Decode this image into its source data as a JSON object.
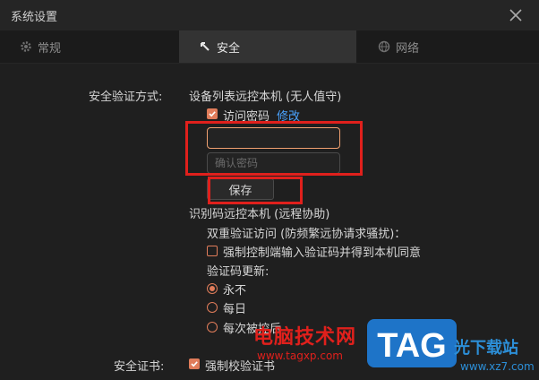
{
  "window": {
    "title": "系统设置"
  },
  "tabs": [
    {
      "label": "常规",
      "icon": "gear-icon"
    },
    {
      "label": "安全",
      "icon": "plug-icon"
    },
    {
      "label": "网络",
      "icon": "globe-icon"
    }
  ],
  "security": {
    "verification_label": "安全验证方式:",
    "device_list_heading": "设备列表远控本机 (无人值守)",
    "access_password": {
      "label": "访问密码",
      "checked": true,
      "modify_link": "修改"
    },
    "password_input": {
      "value": "",
      "placeholder": ""
    },
    "confirm_input": {
      "value": "",
      "placeholder": "确认密码"
    },
    "save_button": "保存",
    "id_code_heading": "识别码远控本机 (远程协助)",
    "two_factor_label": "双重验证访问 (防频繁远协请求骚扰)：",
    "force_verify": {
      "label": "强制控制端输入验证码并得到本机同意",
      "checked": false
    },
    "code_update_label": "验证码更新:",
    "code_update_options": [
      {
        "label": "永不",
        "selected": true
      },
      {
        "label": "每日",
        "selected": false
      },
      {
        "label": "每次被控后",
        "selected": false
      }
    ],
    "cert_label": "安全证书:",
    "force_cert": {
      "label": "强制校验证书",
      "checked": true
    }
  },
  "watermark": {
    "site_name": "电脑技术网",
    "site_url": "www.tagxp.com",
    "logo_text": "TAG",
    "right_text": "光下载站",
    "right_url": "www.xz7.com"
  },
  "colors": {
    "accent": "#e07c5a",
    "link": "#4aa3ff",
    "highlight": "#e0201c",
    "active_tab_bg": "#333333"
  }
}
